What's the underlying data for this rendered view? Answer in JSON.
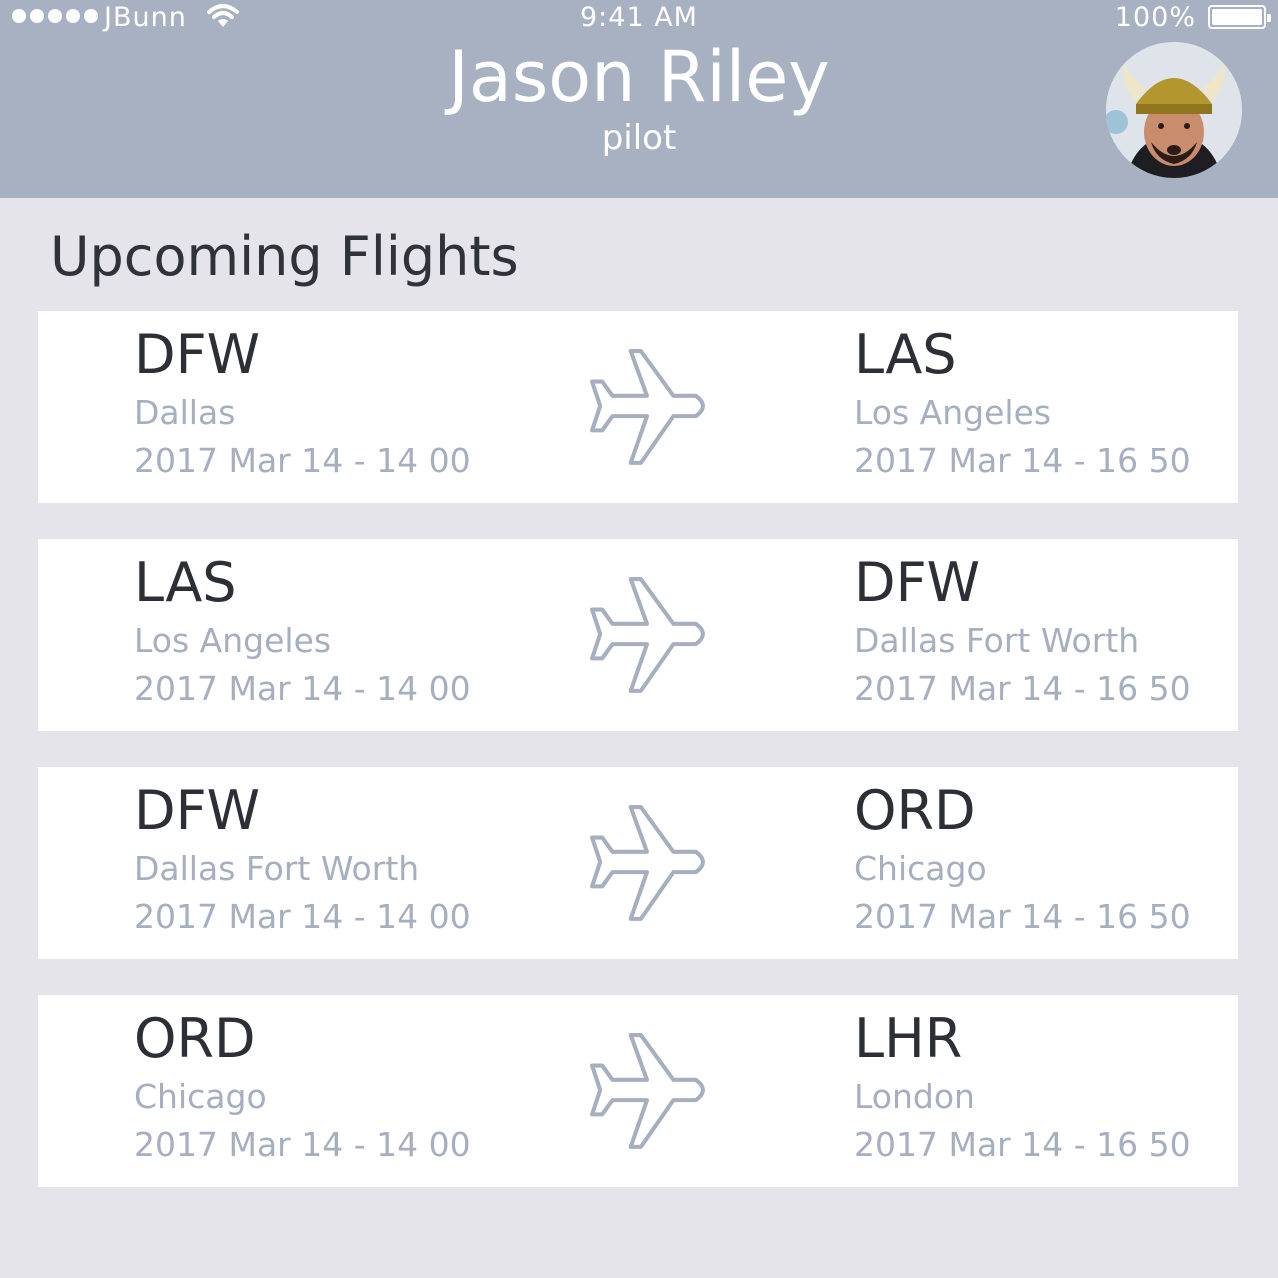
{
  "status": {
    "carrier": "JBunn",
    "time": "9:41 AM",
    "battery": "100%"
  },
  "profile": {
    "name": "Jason Riley",
    "role": "pilot",
    "avatar_icon": "avatar-photo-viking-helmet"
  },
  "section_title": "Upcoming Flights",
  "colors": {
    "header": "#a8b1c2",
    "background": "#e4e4ea",
    "muted_text": "#a6afbf",
    "primary_text": "#2c2f36"
  },
  "flights": [
    {
      "from_code": "DFW",
      "from_city": "Dallas",
      "from_time": "2017 Mar 14 - 14 00",
      "to_code": "LAS",
      "to_city": "Los Angeles",
      "to_time": "2017 Mar 14 - 16 50"
    },
    {
      "from_code": "LAS",
      "from_city": "Los Angeles",
      "from_time": "2017 Mar 14 - 14 00",
      "to_code": "DFW",
      "to_city": "Dallas Fort Worth",
      "to_time": "2017 Mar 14 - 16 50"
    },
    {
      "from_code": "DFW",
      "from_city": "Dallas Fort Worth",
      "from_time": "2017 Mar 14 - 14 00",
      "to_code": "ORD",
      "to_city": "Chicago",
      "to_time": "2017 Mar 14 - 16 50"
    },
    {
      "from_code": "ORD",
      "from_city": "Chicago",
      "from_time": "2017 Mar 14 - 14 00",
      "to_code": "LHR",
      "to_city": "London",
      "to_time": "2017 Mar 14 - 16 50"
    }
  ]
}
